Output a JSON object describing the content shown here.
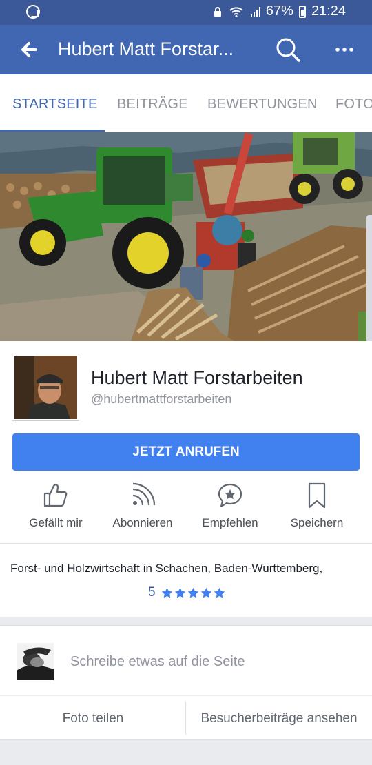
{
  "status_bar": {
    "battery": "67%",
    "time": "21:24",
    "icons": [
      "whatsapp-icon",
      "lock-icon",
      "wifi-icon",
      "signal-icon",
      "battery-icon"
    ]
  },
  "app_bar": {
    "title": "Hubert Matt Forstar...",
    "icons": [
      "back-arrow-icon",
      "search-icon",
      "more-icon"
    ]
  },
  "tabs": [
    {
      "label": "STARTSEITE",
      "active": true
    },
    {
      "label": "BEITRÄGE",
      "active": false
    },
    {
      "label": "BEWERTUNGEN",
      "active": false
    },
    {
      "label": "FOTOS",
      "active": false
    }
  ],
  "profile": {
    "name": "Hubert Matt Forstarbeiten",
    "handle": "@hubertmattforstarbeiten",
    "cta_label": "JETZT ANRUFEN"
  },
  "actions": [
    {
      "label": "Gefällt mir",
      "icon": "like-icon"
    },
    {
      "label": "Abonnieren",
      "icon": "subscribe-icon"
    },
    {
      "label": "Empfehlen",
      "icon": "recommend-icon"
    },
    {
      "label": "Speichern",
      "icon": "bookmark-icon"
    }
  ],
  "about": {
    "description": "Forst- und Holzwirtschaft in Schachen, Baden-Wurttemberg,",
    "rating": "5",
    "stars": 5
  },
  "composer": {
    "placeholder": "Schreibe etwas auf die Seite"
  },
  "bottom_actions": {
    "share_photo": "Foto teilen",
    "visitor_posts": "Besucherbeiträge ansehen"
  },
  "colors": {
    "brand": "#4267b2",
    "status_bar": "#3b5998",
    "cta": "#4080ef",
    "star": "#4080ef"
  }
}
